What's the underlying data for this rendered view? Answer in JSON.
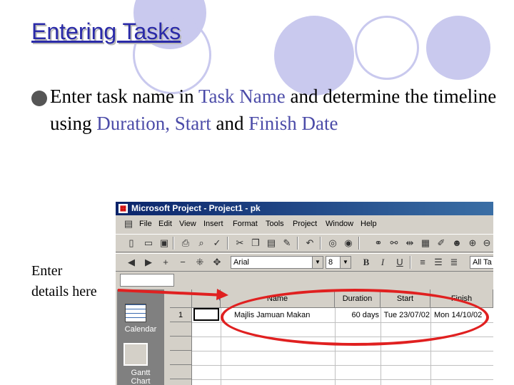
{
  "slide": {
    "title": "Entering Tasks",
    "body_parts": [
      "Enter task name in ",
      "Task Name",
      " and determine the timeline using ",
      "Duration",
      ", ",
      "Start",
      " and ",
      "Finish Date"
    ],
    "callout_line1": "Enter",
    "callout_line2": "details here"
  },
  "app": {
    "window_title": "Microsoft Project - Project1 - pk",
    "menu": [
      "File",
      "Edit",
      "View",
      "Insert",
      "Format",
      "Tools",
      "Project",
      "Window",
      "Help"
    ],
    "font_name": "Arial",
    "font_size": "8",
    "bold": "B",
    "italic": "I",
    "underline": "U",
    "all_tasks": "All Ta",
    "view_bar": {
      "calendar": "Calendar",
      "gantt": "Gantt",
      "gantt2": "Chart"
    },
    "grid": {
      "columns": {
        "name": "Name",
        "duration": "Duration",
        "start": "Start",
        "finish": "Finish"
      },
      "rows": [
        {
          "id": "1",
          "name": "Majlis Jamuan Makan",
          "duration": "60 days",
          "start": "Tue 23/07/02",
          "finish": "Mon 14/10/02"
        }
      ]
    }
  },
  "colors": {
    "title": "#2a2aa8",
    "highlight": "#4b4ba8",
    "circle": "#c9c9ee",
    "annotation": "#e02020"
  }
}
